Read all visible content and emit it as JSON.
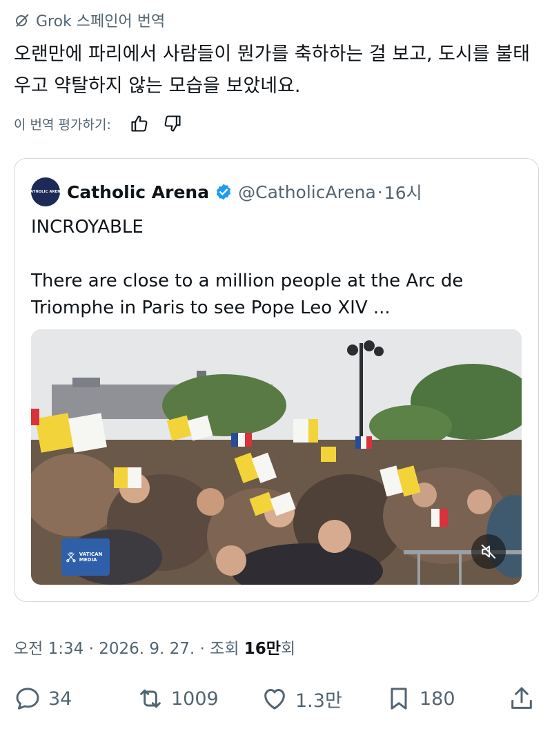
{
  "grok_label": "Grok 스페인어 번역",
  "translated_text": "오랜만에 파리에서 사람들이 뭔가를 축하하는 걸 보고, 도시를 불태우고 약탈하지 않는 모습을 보았네요.",
  "rate_translation_label": "이 번역 평가하기:",
  "quote": {
    "avatar_text": "CATHOLIC ARENA",
    "display_name": "Catholic Arena",
    "handle": "@CatholicArena",
    "separator": "·",
    "time": "16시",
    "headline": "INCROYABLE",
    "body": "There are close to a million people at the Arc de Triomphe in Paris to see Pope Leo XIV ...",
    "media_watermark": "VATICAN MEDIA"
  },
  "meta": {
    "time": "오전 1:34",
    "separator": " · ",
    "date": "2026. 9. 27.",
    "views_label": "조회",
    "views_value": "16만",
    "views_suffix": "회"
  },
  "actions": {
    "replies": "34",
    "reposts": "1009",
    "likes": "1.3만",
    "bookmarks": "180"
  },
  "colors": {
    "secondary_text": "#536471",
    "primary_text": "#0f1419",
    "verified_badge": "#1d9bf0",
    "border": "#cfd9de"
  }
}
